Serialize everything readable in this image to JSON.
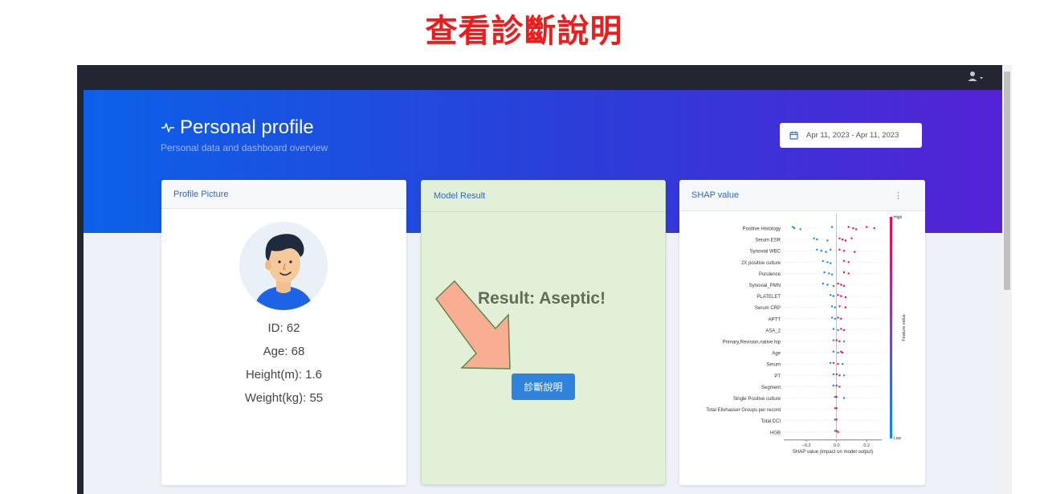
{
  "caption": "查看診斷說明",
  "header": {
    "title": "Personal profile",
    "subtitle": "Personal data and dashboard overview",
    "date_range": "Apr 11, 2023 - Apr 11, 2023"
  },
  "profile_card": {
    "title": "Profile Picture",
    "id": "ID: 62",
    "age": "Age: 68",
    "height": "Height(m): 1.6",
    "weight": "Weight(kg): 55"
  },
  "model_card": {
    "title": "Model Result",
    "result": "Result: Aseptic!",
    "button_label": "診斷說明"
  },
  "shap_card": {
    "title": "SHAP value",
    "menu_icon": "⋮"
  },
  "colors": {
    "caption_red": "#ee1d1d",
    "hero_start": "#0c61e8",
    "hero_end": "#5322d6",
    "model_bg": "#e2f0d8",
    "button_blue": "#2f83dc",
    "arrow_fill": "#f9ad92",
    "arrow_stroke": "#5e8a4a",
    "shap_high": "#ff0052",
    "shap_low": "#008bfb"
  },
  "chart_data": {
    "type": "scatter",
    "title": "",
    "xlabel": "SHAP value (impact on model output)",
    "xlim": [
      -0.35,
      0.3
    ],
    "xticks": [
      -0.2,
      0.0,
      0.2
    ],
    "xtick_labels": [
      "−0.2",
      "0.0",
      "0.2"
    ],
    "colorbar": {
      "label": "Feature value",
      "high": "High",
      "low": "Low"
    },
    "features": [
      "Positive Histology",
      "Serum ESR",
      "Synovial WBC",
      "2X positive culture",
      "Purulence",
      "Synovial_PMN",
      "PLATELET",
      "Serum CRP",
      "APTT",
      "ASA_2",
      "Primary,Revision,native hip",
      "Age",
      "Serum",
      "PT",
      "Segment",
      "Single Positive culture",
      "Total Elixhauser Groups per record",
      "Total CCI",
      "HGB"
    ],
    "series": [
      {
        "low_values": [
          -0.29,
          -0.28,
          -0.24,
          -0.03
        ],
        "high_values": [
          0.08,
          0.11,
          0.13,
          0.2,
          0.25
        ]
      },
      {
        "low_values": [
          -0.15,
          -0.13,
          -0.06
        ],
        "high_values": [
          0.02,
          0.04,
          0.06,
          0.1
        ]
      },
      {
        "low_values": [
          -0.13,
          -0.1,
          -0.07,
          -0.04
        ],
        "high_values": [
          0.02,
          0.05,
          0.12
        ]
      },
      {
        "low_values": [
          -0.09,
          -0.06,
          -0.04
        ],
        "high_values": [
          0.05,
          0.08
        ]
      },
      {
        "low_values": [
          -0.08,
          -0.05,
          -0.03
        ],
        "high_values": [
          0.05,
          0.08
        ]
      },
      {
        "low_values": [
          -0.09,
          -0.06,
          -0.02
        ],
        "high_values": [
          0.01,
          0.03,
          0.05
        ]
      },
      {
        "low_values": [
          -0.04,
          -0.02
        ],
        "high_values": [
          0.01,
          0.03,
          0.06
        ]
      },
      {
        "low_values": [
          -0.03,
          -0.01
        ],
        "high_values": [
          0.02,
          0.06
        ]
      },
      {
        "low_values": [
          -0.03,
          -0.01
        ],
        "high_values": [
          0.01,
          0.03
        ]
      },
      {
        "low_values": [
          -0.02,
          0.01
        ],
        "high_values": [
          0.03,
          0.05
        ]
      },
      {
        "low_values": [
          -0.02,
          0.05
        ],
        "high_values": [
          0.0,
          0.02
        ]
      },
      {
        "low_values": [
          -0.02,
          0.01
        ],
        "high_values": [
          0.03,
          0.04
        ]
      },
      {
        "low_values": [
          -0.04,
          0.04
        ],
        "high_values": [
          -0.02,
          0.01
        ]
      },
      {
        "low_values": [
          -0.02,
          0.05
        ],
        "high_values": [
          0.0,
          0.02
        ]
      },
      {
        "low_values": [
          -0.02
        ],
        "high_values": [
          0.0,
          0.02
        ]
      },
      {
        "low_values": [
          -0.01,
          0.05
        ],
        "high_values": [
          0.0
        ]
      },
      {
        "low_values": [
          -0.01
        ],
        "high_values": [
          0.0
        ]
      },
      {
        "low_values": [
          -0.01
        ],
        "high_values": [
          0.0
        ]
      },
      {
        "low_values": [
          -0.01
        ],
        "high_values": [
          0.0,
          0.01
        ]
      }
    ]
  }
}
